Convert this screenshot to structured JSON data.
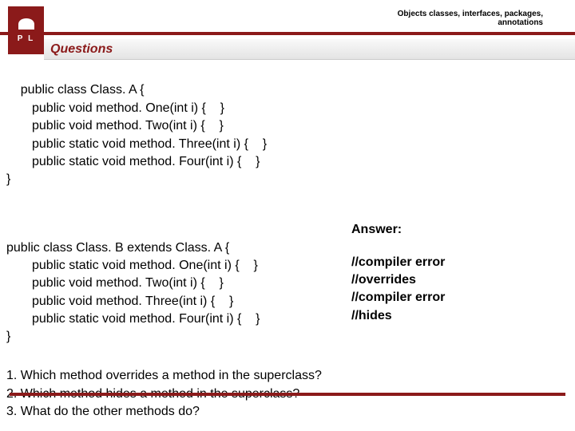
{
  "header": {
    "breadcrumb_line1": "Objects classes, interfaces, packages,",
    "breadcrumb_line2": "annotations",
    "logo_letters": "P   L"
  },
  "section": {
    "title": "Questions"
  },
  "classA": {
    "decl": "public class Class. A {",
    "m1": "public void method. One(int i) {    }",
    "m2": "public void method. Two(int i) {    }",
    "m3": "public static void method. Three(int i) {    }",
    "m4": "public static void method. Four(int i) {    }",
    "close": "}"
  },
  "classB": {
    "decl": "public class Class. B extends Class. A {",
    "m1": "public static void method. One(int i) {    }",
    "m2": "public void method. Two(int i) {    }",
    "m3": "public void method. Three(int i) {    }",
    "m4": "public static void method. Four(int i) {    }",
    "close": "}"
  },
  "answer": {
    "heading": "Answer:",
    "a1": "//compiler error",
    "a2": "//overrides",
    "a3": "//compiler error",
    "a4": "//hides"
  },
  "questions": {
    "q1": "1. Which method overrides a method in the superclass?",
    "q2": "2. Which method hides a method in the superclass?",
    "q3": "3. What do the other methods do?"
  }
}
